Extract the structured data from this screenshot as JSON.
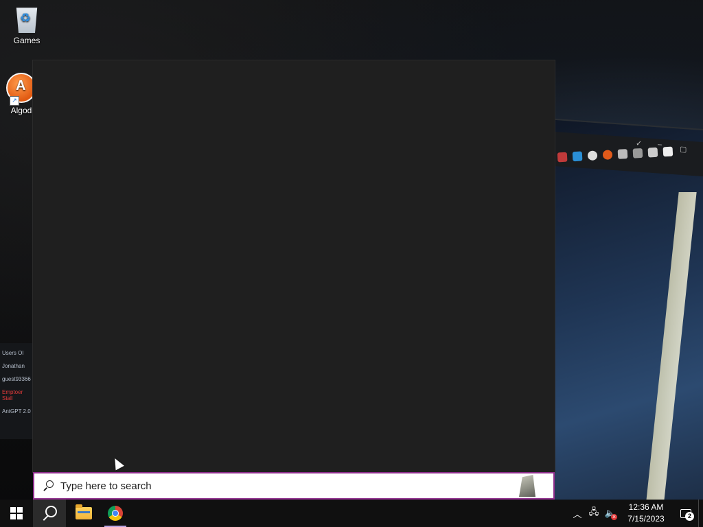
{
  "desktop": {
    "icons": [
      {
        "label": "Games",
        "icon": "recycle-bin-icon"
      },
      {
        "label": "Algod",
        "icon": "algodoo-icon"
      }
    ]
  },
  "background_photo": {
    "left_strip_lines": [
      "Users Ol",
      "Jonathan",
      "guest93366",
      "Emptoer Stall",
      "AntGPT 2.0"
    ]
  },
  "search": {
    "placeholder": "Type here to search",
    "accent_color": "#8e2d8c"
  },
  "taskbar": {
    "start_label": "Start",
    "search_label": "Search",
    "apps": [
      {
        "name": "File Explorer",
        "icon": "folder-icon"
      },
      {
        "name": "Google Chrome",
        "icon": "chrome-icon",
        "open": true
      }
    ],
    "tray": {
      "chevron": "^",
      "network_icon": "network-icon",
      "volume_icon": "volume-muted-icon",
      "time": "12:36 AM",
      "date": "7/15/2023",
      "notification_count": "2"
    }
  }
}
